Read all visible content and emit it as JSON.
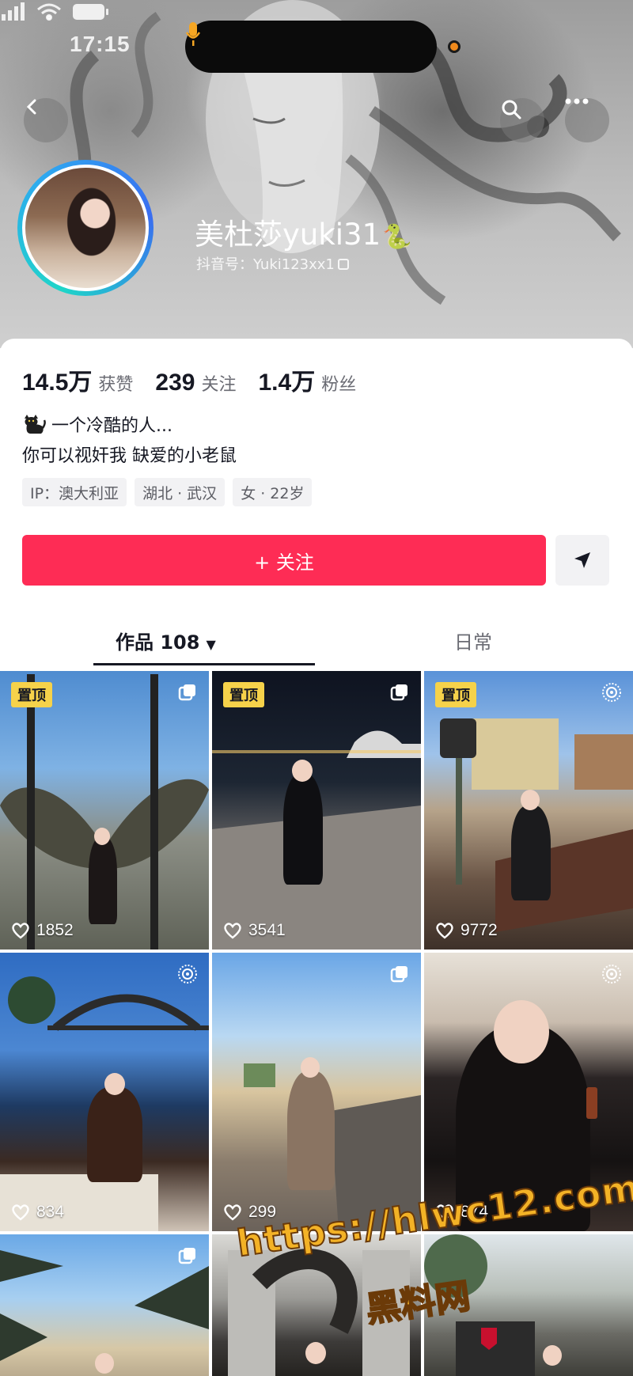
{
  "status_bar": {
    "time": "17:15"
  },
  "header": {
    "display_name": "美杜莎yuki31",
    "name_emoji": "🐍",
    "douyin_id": "抖音号：Yuki123xx1"
  },
  "stats": [
    {
      "value": "14.5万",
      "label": "获赞"
    },
    {
      "value": "239",
      "label": "关注"
    },
    {
      "value": "1.4万",
      "label": "粉丝"
    }
  ],
  "bio": {
    "line1": "一个冷酷的人...",
    "line2": "你可以视奸我 缺爱的小老鼠"
  },
  "tags": [
    "IP：澳大利亚",
    "湖北 · 武汉",
    "女 · 22岁"
  ],
  "actions": {
    "follow_label": "+ 关注"
  },
  "tabs": {
    "works_label": "作品 108",
    "works_arrow": "▼",
    "daily_label": "日常"
  },
  "grid": [
    {
      "likes": "1852",
      "pinned": "置顶",
      "corner": "multi-image-icon"
    },
    {
      "likes": "3541",
      "pinned": "置顶",
      "corner": "multi-image-icon"
    },
    {
      "likes": "9772",
      "pinned": "置顶",
      "corner": "live-photo-icon"
    },
    {
      "likes": "834",
      "corner": "live-photo-icon"
    },
    {
      "likes": "299",
      "corner": "multi-image-icon"
    },
    {
      "likes": "874",
      "corner": "live-photo-icon"
    },
    {
      "corner": "multi-image-icon"
    },
    {},
    {}
  ],
  "watermark": {
    "url": "https://hlwc12.com",
    "brand": "黑料网"
  },
  "colors": {
    "accent": "#fe2c55",
    "pin": "#f6d24a",
    "watermark": "#f3b226"
  }
}
